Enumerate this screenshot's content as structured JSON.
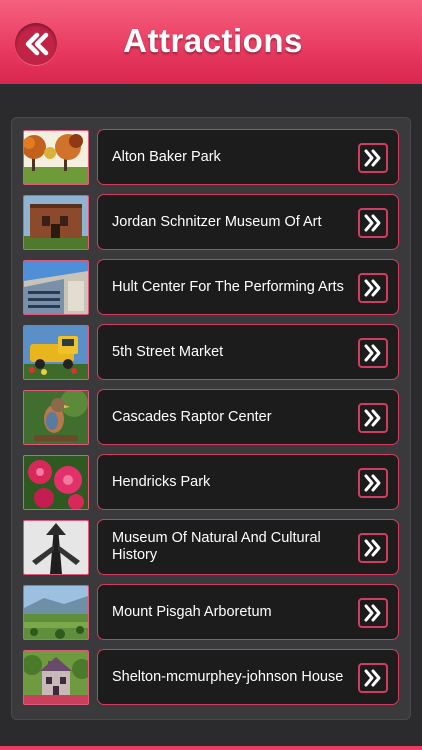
{
  "header": {
    "title": "Attractions",
    "back_icon": "double-chevron-left-icon"
  },
  "colors": {
    "header_pink": "#ea3d63",
    "accent_border": "#d23c61",
    "background": "#2b2b2d",
    "item_background": "#1c1c1d"
  },
  "attractions": [
    {
      "label": "Alton Baker Park",
      "thumbnail": "autumn-park-trees"
    },
    {
      "label": "Jordan Schnitzer Museum Of Art",
      "thumbnail": "brick-museum-building"
    },
    {
      "label": "Hult Center For The Performing Arts",
      "thumbnail": "glass-building-blue-sky"
    },
    {
      "label": "5th Street Market",
      "thumbnail": "yellow-vintage-truck"
    },
    {
      "label": "Cascades Raptor Center",
      "thumbnail": "kestrel-bird"
    },
    {
      "label": "Hendricks Park",
      "thumbnail": "pink-rhododendron"
    },
    {
      "label": "Museum Of Natural And Cultural History",
      "thumbnail": "totem-pole-silhouette"
    },
    {
      "label": "Mount Pisgah Arboretum",
      "thumbnail": "valley-landscape"
    },
    {
      "label": "Shelton-mcmurphey-johnson House",
      "thumbnail": "victorian-house"
    }
  ],
  "row_action_icon": "double-chevron-right-icon"
}
